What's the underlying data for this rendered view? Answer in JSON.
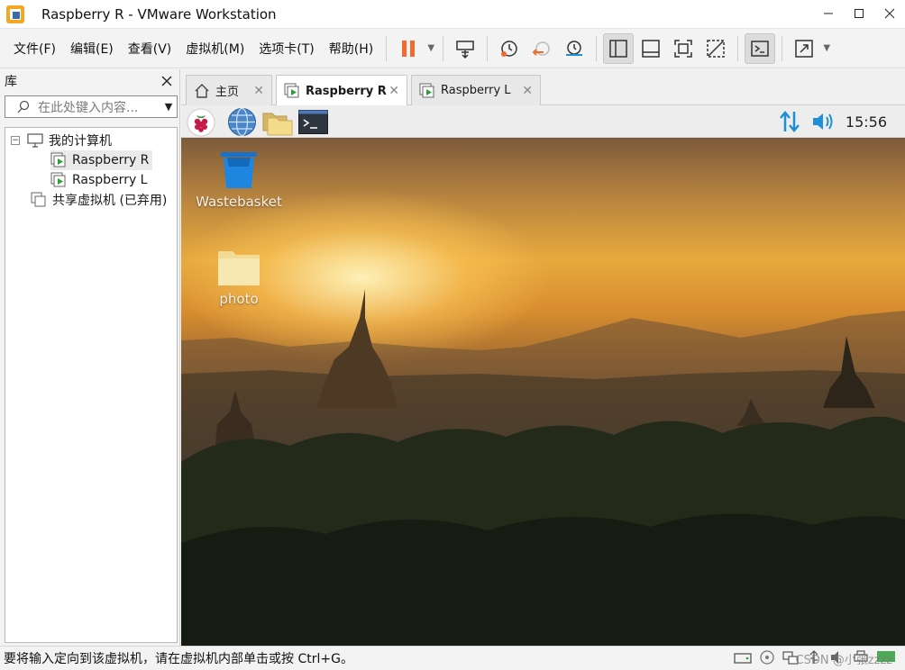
{
  "window": {
    "title": "Raspberry R - VMware Workstation"
  },
  "menu": {
    "items": [
      "文件(F)",
      "编辑(E)",
      "查看(V)",
      "虚拟机(M)",
      "选项卡(T)",
      "帮助(H)"
    ]
  },
  "toolbar": {
    "icons": [
      "pause-icon",
      "send-ctrl-alt-del-icon",
      "snapshot-icon",
      "revert-snapshot-icon",
      "snapshot-manager-icon",
      "show-library-icon",
      "thumbnail-bar-icon",
      "full-screen-icon",
      "unity-icon",
      "console-view-icon",
      "stretch-icon"
    ]
  },
  "library": {
    "title": "库",
    "search_placeholder": "在此处键入内容...",
    "tree": {
      "root": "我的计算机",
      "vms": [
        "Raspberry R",
        "Raspberry L"
      ],
      "shared": "共享虚拟机 (已弃用)"
    }
  },
  "tabs": [
    {
      "label": "主页"
    },
    {
      "label": "Raspberry R"
    },
    {
      "label": "Raspberry L"
    }
  ],
  "guest": {
    "clock": "15:56",
    "desktop_icons": [
      {
        "label": "Wastebasket"
      },
      {
        "label": "photo"
      }
    ]
  },
  "status": {
    "message": "要将输入定向到该虚拟机，请在虚拟机内部单击或按 Ctrl+G。",
    "watermark": "CSDN @小张zzzz"
  },
  "colors": {
    "pause_accent": "#f26a2e",
    "volume_blue": "#1e90d6",
    "title_bg": "#ffffff",
    "chrome_bg": "#f3f3f3"
  }
}
